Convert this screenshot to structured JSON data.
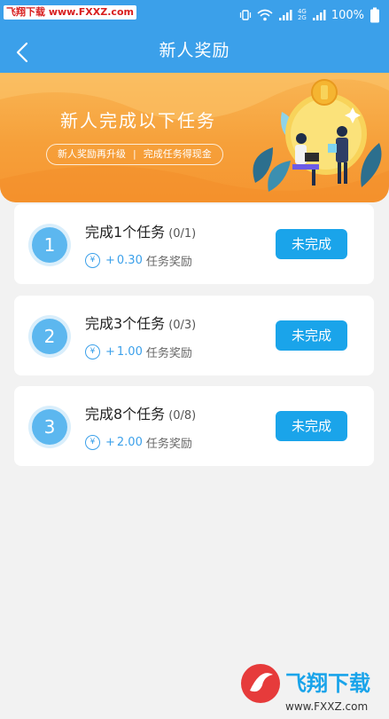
{
  "status_bar": {
    "watermark": "飞翔下载 www.FXXZ.com",
    "net_top": "4G",
    "net_bottom": "2G",
    "battery": "100%"
  },
  "header": {
    "title": "新人奖励"
  },
  "banner": {
    "title": "新人完成以下任务",
    "tag_left": "新人奖励再升级",
    "tag_sep": "|",
    "tag_right": "完成任务得现金"
  },
  "tasks": [
    {
      "number": "1",
      "title": "完成1个任务",
      "progress": "(0/1)",
      "coin_symbol": "¥",
      "plus": "+",
      "amount": "0.30",
      "reward_label": "任务奖励",
      "status": "未完成"
    },
    {
      "number": "2",
      "title": "完成3个任务",
      "progress": "(0/3)",
      "coin_symbol": "¥",
      "plus": "+",
      "amount": "1.00",
      "reward_label": "任务奖励",
      "status": "未完成"
    },
    {
      "number": "3",
      "title": "完成8个任务",
      "progress": "(0/8)",
      "coin_symbol": "¥",
      "plus": "+",
      "amount": "2.00",
      "reward_label": "任务奖励",
      "status": "未完成"
    }
  ],
  "footer_logo": {
    "text": "飞翔下载",
    "url": "www.FXXZ.com"
  },
  "colors": {
    "primary": "#3ba0ea",
    "button": "#1aa4ea",
    "banner": "#f6a03a",
    "badge": "#5cb7ef"
  }
}
